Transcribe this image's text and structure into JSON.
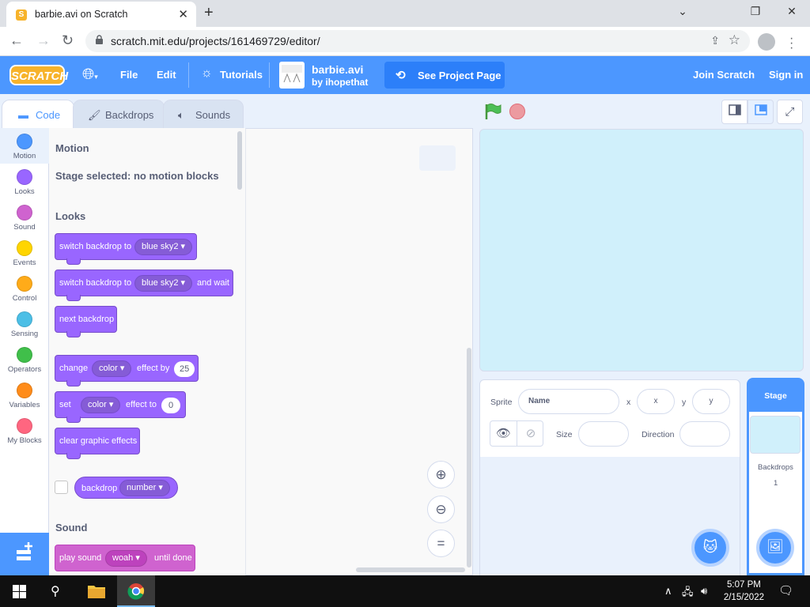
{
  "browser": {
    "tab_title": "barbie.avi on Scratch",
    "tab_close": "✕",
    "new_tab": "+",
    "url": "scratch.mit.edu/projects/161469729/editor/",
    "window": {
      "minimize": "⌄",
      "restore": "❐",
      "close": "✕"
    }
  },
  "menubar": {
    "logo": "SCRATCH",
    "file": "File",
    "edit": "Edit",
    "tutorials": "Tutorials",
    "project_title": "barbie.avi",
    "project_author": "by ihopethat",
    "see_project_page": "See Project Page",
    "join": "Join Scratch",
    "signin": "Sign in"
  },
  "tabs": {
    "code": "Code",
    "backdrops": "Backdrops",
    "sounds": "Sounds"
  },
  "categories": [
    {
      "label": "Motion",
      "color": "#4c97ff"
    },
    {
      "label": "Looks",
      "color": "#9966ff"
    },
    {
      "label": "Sound",
      "color": "#cf63cf"
    },
    {
      "label": "Events",
      "color": "#ffd500"
    },
    {
      "label": "Control",
      "color": "#ffab19"
    },
    {
      "label": "Sensing",
      "color": "#4cbfe6"
    },
    {
      "label": "Operators",
      "color": "#40bf4a"
    },
    {
      "label": "Variables",
      "color": "#ff8c1a"
    },
    {
      "label": "My Blocks",
      "color": "#ff6680"
    }
  ],
  "palette": {
    "motion_heading": "Motion",
    "motion_note": "Stage selected: no motion blocks",
    "looks_heading": "Looks",
    "sound_heading": "Sound",
    "blocks": {
      "switch_backdrop": {
        "text": "switch backdrop to",
        "value": "blue sky2"
      },
      "switch_backdrop_wait": {
        "text": "switch backdrop to",
        "value": "blue sky2",
        "suffix": "and wait"
      },
      "next_backdrop": {
        "text": "next backdrop"
      },
      "change_effect": {
        "text": "change",
        "value": "color",
        "mid": "effect by",
        "num": "25"
      },
      "set_effect": {
        "text": "set",
        "value": "color",
        "mid": "effect to",
        "num": "0"
      },
      "clear_effects": {
        "text": "clear graphic effects"
      },
      "backdrop_reporter": {
        "text": "backdrop",
        "value": "number"
      },
      "play_sound": {
        "text": "play sound",
        "value": "woah",
        "suffix": "until done"
      }
    }
  },
  "zoom": {
    "in": "⊕",
    "out": "⊖",
    "reset": "="
  },
  "sprite_info": {
    "sprite_label": "Sprite",
    "name_placeholder": "Name",
    "x_label": "x",
    "x_placeholder": "x",
    "y_label": "y",
    "y_placeholder": "y",
    "size_label": "Size",
    "direction_label": "Direction"
  },
  "stage_selector": {
    "header": "Stage",
    "backdrops_label": "Backdrops",
    "backdrops_count": "1"
  },
  "taskbar": {
    "time": "5:07 PM",
    "date": "2/15/2022"
  }
}
